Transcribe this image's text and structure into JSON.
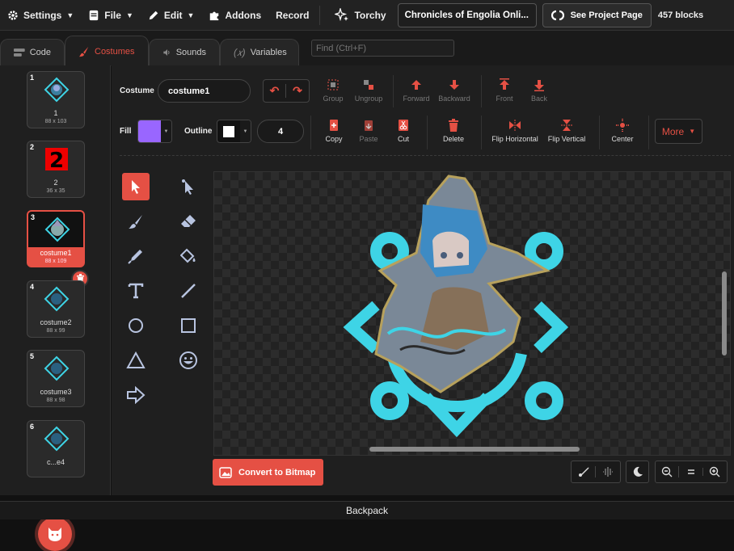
{
  "menubar": {
    "settings": "Settings",
    "file": "File",
    "edit": "Edit",
    "addons": "Addons",
    "record": "Record",
    "torchy": "Torchy",
    "project_title": "Chronicles of Engolia Onli...",
    "see_project": "See Project Page",
    "blocks": "457 blocks"
  },
  "tabs": {
    "code": "Code",
    "costumes": "Costumes",
    "sounds": "Sounds",
    "variables": "Variables",
    "find_placeholder": "Find (Ctrl+F)"
  },
  "costumes": [
    {
      "num": "1",
      "name": "1",
      "size": "88 x 103"
    },
    {
      "num": "2",
      "name": "2",
      "size": "36 x 35"
    },
    {
      "num": "3",
      "name": "costume1",
      "size": "88 x 109"
    },
    {
      "num": "4",
      "name": "costume2",
      "size": "88 x 99"
    },
    {
      "num": "5",
      "name": "costume3",
      "size": "88 x 98"
    },
    {
      "num": "6",
      "name": "c...e4",
      "size": ""
    }
  ],
  "toolbar": {
    "costume_label": "Costume",
    "costume_name": "costume1",
    "group": "Group",
    "ungroup": "Ungroup",
    "forward": "Forward",
    "backward": "Backward",
    "front": "Front",
    "back": "Back",
    "fill_label": "Fill",
    "fill_color": "#9966ff",
    "outline_label": "Outline",
    "outline_color": "#ffffff",
    "outline_width": "4",
    "copy": "Copy",
    "paste": "Paste",
    "cut": "Cut",
    "delete": "Delete",
    "flip_h": "Flip Horizontal",
    "flip_v": "Flip Vertical",
    "center": "Center",
    "more": "More"
  },
  "convert_bitmap": "Convert to Bitmap",
  "backpack": "Backpack",
  "colors": {
    "accent": "#e55044",
    "cyan": "#3ed4e6"
  }
}
